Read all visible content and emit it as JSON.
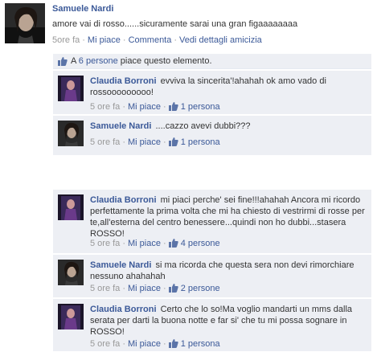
{
  "post": {
    "author": "Samuele Nardi",
    "message": "amore vai di rosso......sicuramente sarai una gran figaaaaaaaa",
    "time": "5ore fa",
    "like_label": "Mi piace",
    "comment_label": "Commenta",
    "friendship_label": "Vedi dettagli amicizia"
  },
  "likes": {
    "prefix": "A ",
    "count_link": "6 persone",
    "suffix": " piace questo elemento."
  },
  "comments": [
    {
      "author": "Claudia Borroni",
      "text": "evviva la sincerita'!ahahah ok amo vado di rossooooooooo!",
      "time": "5 ore fa",
      "like_label": "Mi piace",
      "likes": "1 persona"
    },
    {
      "author": "Samuele Nardi",
      "text": "....cazzo avevi dubbi???",
      "time": "5 ore fa",
      "like_label": "Mi piace",
      "likes": "1 persona"
    },
    {
      "author": "Claudia Borroni",
      "text": "mi piaci perche' sei fine!!!ahahah Ancora mi ricordo perfettamente la prima volta che mi ha chiesto di vestrirmi di rosse per te,all'esterna del centro benessere...quindi non ho dubbi...stasera ROSSO!",
      "time": "5 ore fa",
      "like_label": "Mi piace",
      "likes": "4 persone"
    },
    {
      "author": "Samuele Nardi",
      "text": "si ma ricorda che questa sera non devi rimorchiare nessuno ahahahah",
      "time": "5 ore fa",
      "like_label": "Mi piace",
      "likes": "2 persone"
    },
    {
      "author": "Claudia Borroni",
      "text": "Certo che lo so!Ma voglio mandarti un mms dalla serata per darti la buona notte e far si' che tu mi possa sognare in ROSSO!",
      "time": "5 ore fa",
      "like_label": "Mi piace",
      "likes": "1 persona"
    }
  ],
  "separator": "·",
  "colors": {
    "link": "#3b5998",
    "comment_bg": "#edeff4",
    "meta": "#999999"
  },
  "icons": {
    "like": "thumbs-up-icon"
  }
}
